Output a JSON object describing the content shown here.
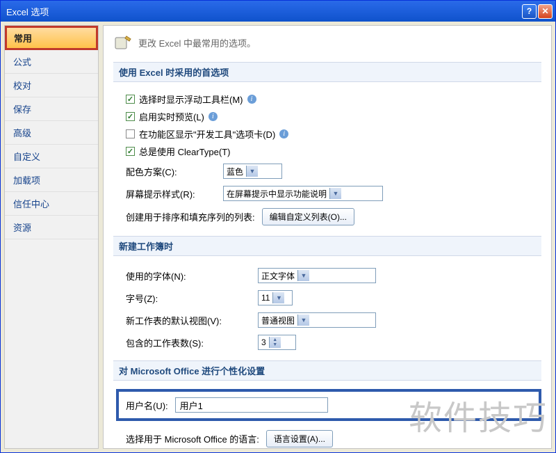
{
  "window": {
    "title": "Excel 选项"
  },
  "sidebar": {
    "items": [
      {
        "label": "常用",
        "active": true
      },
      {
        "label": "公式"
      },
      {
        "label": "校对"
      },
      {
        "label": "保存"
      },
      {
        "label": "高级"
      },
      {
        "label": "自定义"
      },
      {
        "label": "加载项"
      },
      {
        "label": "信任中心"
      },
      {
        "label": "资源"
      }
    ]
  },
  "header": {
    "text": "更改 Excel 中最常用的选项。"
  },
  "group1": {
    "title": "使用 Excel 时采用的首选项",
    "opt_float_toolbar": "选择时显示浮动工具栏(M)",
    "opt_live_preview": "启用实时预览(L)",
    "opt_dev_tab": "在功能区显示\"开发工具\"选项卡(D)",
    "opt_cleartype": "总是使用 ClearType(T)",
    "color_scheme_label": "配色方案(C):",
    "color_scheme_value": "蓝色",
    "tooltip_label": "屏幕提示样式(R):",
    "tooltip_value": "在屏幕提示中显示功能说明",
    "custom_list_label": "创建用于排序和填充序列的列表:",
    "custom_list_btn": "编辑自定义列表(O)..."
  },
  "group2": {
    "title": "新建工作簿时",
    "font_label": "使用的字体(N):",
    "font_value": "正文字体",
    "size_label": "字号(Z):",
    "size_value": "11",
    "view_label": "新工作表的默认视图(V):",
    "view_value": "普通视图",
    "sheets_label": "包含的工作表数(S):",
    "sheets_value": "3"
  },
  "group3": {
    "title": "对 Microsoft Office 进行个性化设置",
    "username_label": "用户名(U):",
    "username_value": "用户1",
    "lang_label": "选择用于 Microsoft Office 的语言:",
    "lang_btn": "语言设置(A)..."
  },
  "watermark": "软件技巧"
}
